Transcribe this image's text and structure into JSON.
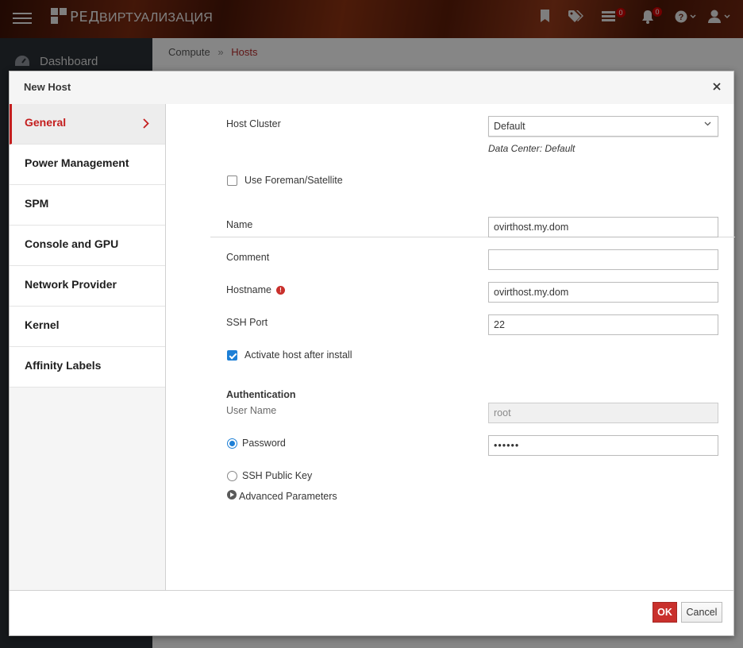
{
  "header": {
    "brand_text": "РЕД",
    "product_name": "ВИРТУАЛИЗАЦИЯ",
    "icons": [
      "menu-icon",
      "bookmark-icon",
      "tag-icon",
      "tasks-icon",
      "bell-icon",
      "help-icon",
      "user-icon"
    ],
    "tasks_count": "0",
    "notifications_count": "0"
  },
  "background": {
    "sidebar_dashboard": "Dashboard",
    "breadcrumb": [
      "Compute",
      "Hosts"
    ],
    "breadcrumb_separator": "»"
  },
  "modal": {
    "title": "New Host",
    "close_label": "×",
    "tabs": [
      {
        "label": "General",
        "active": true
      },
      {
        "label": "Power Management"
      },
      {
        "label": "SPM"
      },
      {
        "label": "Console and GPU"
      },
      {
        "label": "Network Provider"
      },
      {
        "label": "Kernel"
      },
      {
        "label": "Affinity Labels"
      }
    ],
    "general": {
      "host_cluster_label": "Host Cluster",
      "host_cluster_value": "Default",
      "data_center_hint": "Data Center: Default",
      "use_foreman_label": "Use Foreman/Satellite",
      "use_foreman_checked": false,
      "name_label": "Name",
      "name_value": "ovirthost.my.dom",
      "comment_label": "Comment",
      "comment_value": "",
      "hostname_label": "Hostname",
      "hostname_info_icon": "!",
      "hostname_value": "ovirthost.my.dom",
      "ssh_port_label": "SSH Port",
      "ssh_port_value": "22",
      "activate_label": "Activate host after install",
      "activate_checked": true,
      "auth_title": "Authentication",
      "username_label": "User Name",
      "username_value": "root",
      "password_label": "Password",
      "password_value": "••••••",
      "password_selected": true,
      "ssh_key_label": "SSH Public Key",
      "advanced_label": "Advanced Parameters"
    },
    "footer": {
      "ok_label": "OK",
      "cancel_label": "Cancel"
    }
  },
  "colors": {
    "accent_red": "#c41e1e",
    "ok_button": "#c9302c",
    "checkbox_blue": "#1d7fd6",
    "badge_red": "#cc0000"
  }
}
